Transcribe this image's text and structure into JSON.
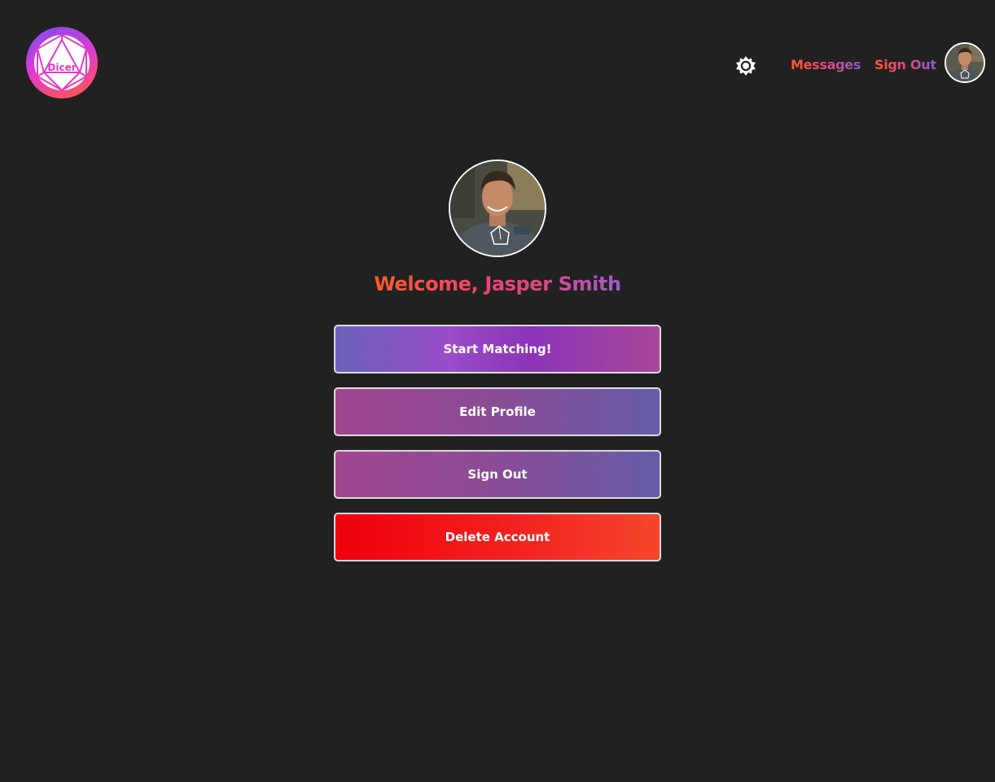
{
  "header": {
    "logo_text": "Dicer",
    "theme_toggle_icon": "sun-icon",
    "nav": {
      "messages_label": "Messages",
      "sign_out_label": "Sign Out"
    },
    "avatar_icon": "user-avatar"
  },
  "main": {
    "welcome_text": "Welcome, Jasper Smith",
    "buttons": {
      "start_matching": "Start Matching!",
      "edit_profile": "Edit Profile",
      "sign_out": "Sign Out",
      "delete_account": "Delete Account"
    }
  },
  "colors": {
    "background": "#212121",
    "delete_red": "#f0000e",
    "button_purple": "#8a4c96",
    "accent_orange": "#ff5a2e"
  }
}
